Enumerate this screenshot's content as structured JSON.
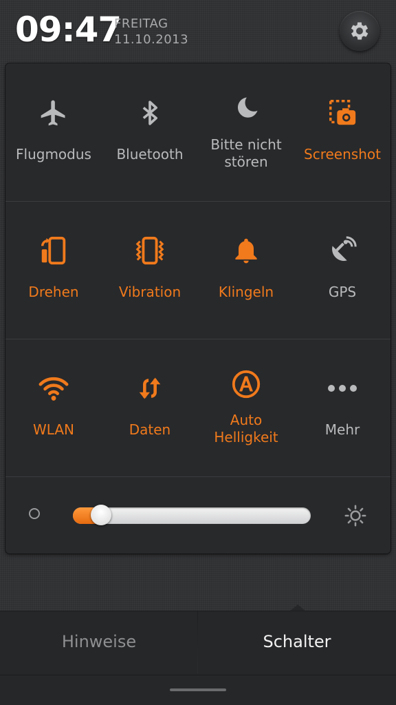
{
  "status": {
    "time": "09:47",
    "weekday": "FREITAG",
    "date": "11.10.2013"
  },
  "colors": {
    "accent": "#f07a1c",
    "inactive": "#b9babc",
    "panel": "#28292b"
  },
  "toggles": [
    {
      "label": "Flugmodus",
      "icon": "airplane-icon",
      "active": false
    },
    {
      "label": "Bluetooth",
      "icon": "bluetooth-icon",
      "active": false
    },
    {
      "label": "Bitte nicht stören",
      "line1": "Bitte nicht",
      "line2": "stören",
      "icon": "moon-icon",
      "active": false
    },
    {
      "label": "Screenshot",
      "icon": "screenshot-icon",
      "active": true
    },
    {
      "label": "Drehen",
      "icon": "rotate-icon",
      "active": true
    },
    {
      "label": "Vibration",
      "icon": "vibration-icon",
      "active": true
    },
    {
      "label": "Klingeln",
      "icon": "bell-icon",
      "active": true
    },
    {
      "label": "GPS",
      "icon": "gps-icon",
      "active": false
    },
    {
      "label": "WLAN",
      "icon": "wifi-icon",
      "active": true
    },
    {
      "label": "Daten",
      "icon": "data-icon",
      "active": true
    },
    {
      "label": "Auto Helligkeit",
      "line1": "Auto",
      "line2": "Helligkeit",
      "icon": "auto-brightness-icon",
      "active": true
    },
    {
      "label": "Mehr",
      "icon": "more-icon",
      "active": false
    }
  ],
  "brightness": {
    "level": 0.08
  },
  "tabs": [
    {
      "label": "Hinweise",
      "selected": false
    },
    {
      "label": "Schalter",
      "selected": true
    }
  ]
}
